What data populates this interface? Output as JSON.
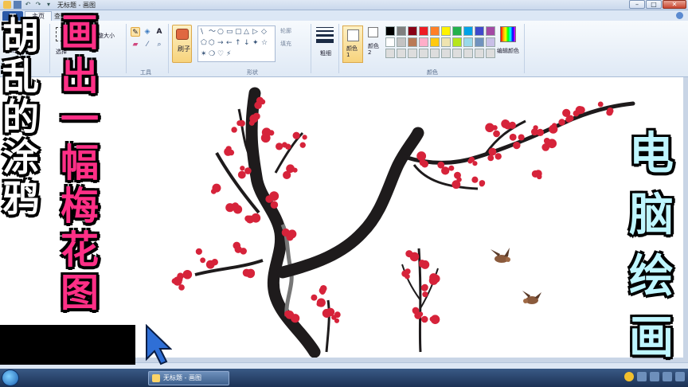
{
  "window": {
    "title": "无标题 - 画图",
    "qat_icons": [
      "paint-app-icon",
      "save-icon",
      "undo-icon",
      "redo-icon",
      "dropdown-icon"
    ],
    "controls": [
      "minimize",
      "maximize",
      "close"
    ]
  },
  "ribbon_tabs": {
    "file_icon": "paint-menu-icon",
    "home": "主页",
    "view": "查看"
  },
  "ribbon": {
    "clipboard": {
      "paste": "粘贴"
    },
    "image": {
      "select": "选择",
      "resize": "重新调整大小",
      "rotate": "旋转"
    },
    "tools": {
      "label": "工具",
      "icons": [
        "pencil-icon",
        "fill-icon",
        "text-icon",
        "eraser-icon",
        "color-picker-icon",
        "magnifier-icon"
      ]
    },
    "brush": {
      "label": "刷子"
    },
    "shapes": {
      "label": "形状",
      "outline": "轮廓",
      "fill": "填充",
      "glyphs": [
        "\\",
        "〜",
        "○",
        "▭",
        "▢",
        "△",
        "▷",
        "◇",
        "⬠",
        "⬡",
        "→",
        "←",
        "↑",
        "↓",
        "✦",
        "☆",
        "✶",
        "❍",
        "♡",
        "⚡"
      ]
    },
    "size": {
      "label": "粗细"
    },
    "colors": {
      "label": "颜色",
      "color1": "颜色 1",
      "color2": "颜色 2",
      "edit": "编辑颜色",
      "palette": [
        "#000000",
        "#7f7f7f",
        "#880015",
        "#ed1c24",
        "#ff7f27",
        "#fff200",
        "#22b14c",
        "#00a2e8",
        "#3f48cc",
        "#a349a4",
        "#ffffff",
        "#c3c3c3",
        "#b97a57",
        "#ffaec9",
        "#ffc90e",
        "#efe4b0",
        "#b5e61d",
        "#99d9ea",
        "#7092be",
        "#c8bfe7",
        "#dddddd",
        "#dddddd",
        "#dddddd",
        "#dddddd",
        "#dddddd",
        "#dddddd",
        "#dddddd",
        "#dddddd",
        "#dddddd",
        "#dddddd"
      ]
    }
  },
  "taskbar": {
    "task": "无标题 - 画图",
    "tray_icons": [
      "network-icon",
      "volume-icon",
      "flag-icon",
      "shield-icon",
      "keyboard-icon"
    ]
  },
  "overlay": {
    "left_caption": "胡乱的涂鸦",
    "middle_caption": "画出一幅梅花图",
    "right_caption": "电脑绘画"
  },
  "colors": {
    "blossom": "#d6233a",
    "branch": "#1e1b1c",
    "bird": "#8a5a3c"
  }
}
